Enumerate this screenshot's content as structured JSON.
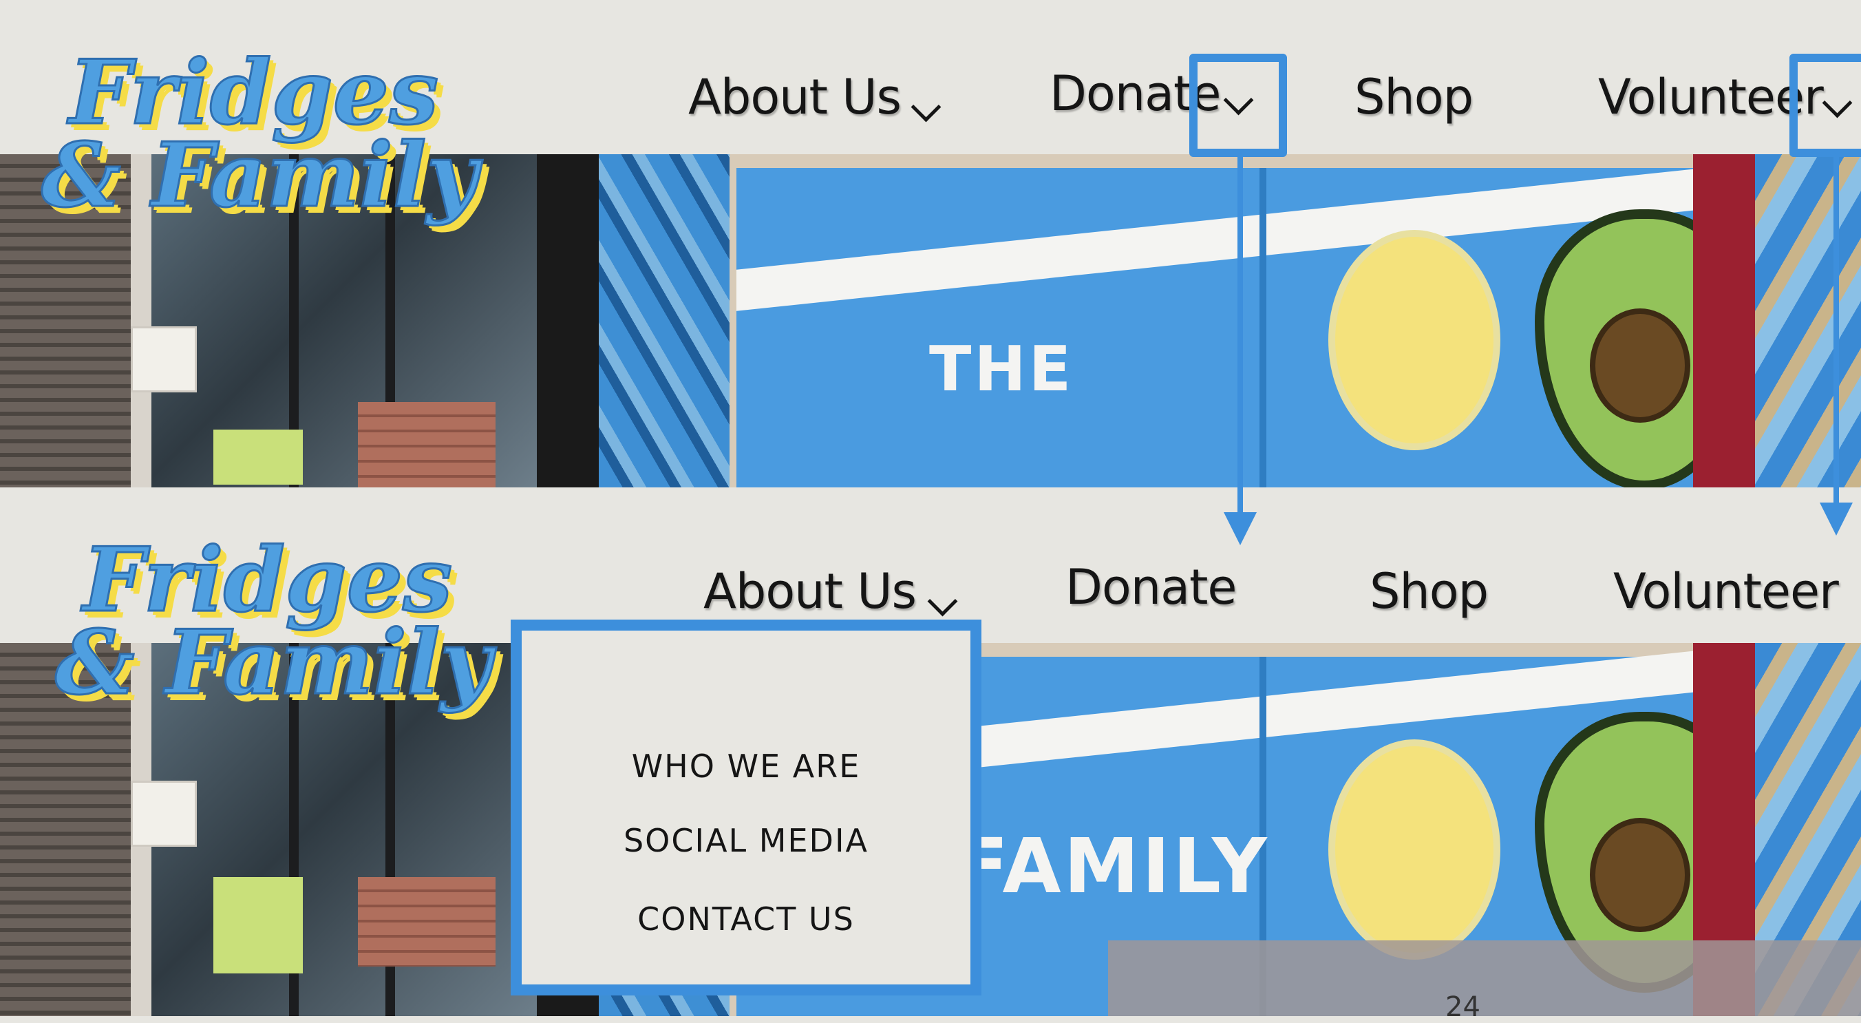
{
  "logo": {
    "line1": "Fridges",
    "line2": "& Family"
  },
  "nav": {
    "about": "About Us",
    "donate": "Donate",
    "shop": "Shop",
    "volunteer": "Volunteer"
  },
  "photo": {
    "fridge_text_1": "THE",
    "fridge_text_2": "FAMILY"
  },
  "dropdown": {
    "items": [
      "WHO WE ARE",
      "SOCIAL MEDIA",
      "CONTACT US"
    ]
  },
  "page_number": "24",
  "colors": {
    "highlight": "#3d8fdc",
    "logo_blue": "#4f9fe0",
    "logo_yellow": "#f5dc47",
    "nav_bg": "#e7e6e1"
  }
}
